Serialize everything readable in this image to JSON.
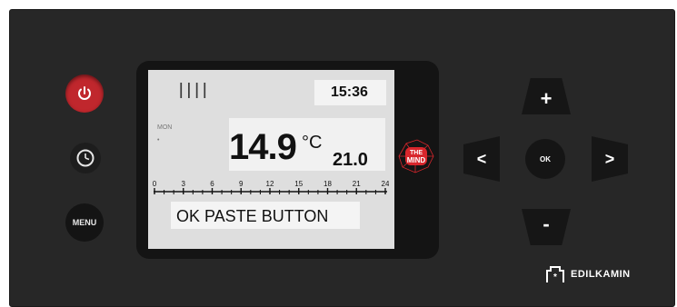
{
  "controls": {
    "power_icon": "power-icon",
    "clock_icon": "clock-icon",
    "menu_label": "MENU",
    "up_label": "+",
    "down_label": "-",
    "left_label": "<",
    "right_label": ">",
    "ok_label": "OK"
  },
  "display": {
    "time": "15:36",
    "day": "MON",
    "dot": "•",
    "temperature": "14.9",
    "unit": "°C",
    "setpoint": "21.0",
    "hour_ticks": [
      "0",
      "3",
      "6",
      "9",
      "12",
      "15",
      "18",
      "21",
      "24"
    ],
    "message": "OK PASTE BUTTON"
  },
  "badge": {
    "line1": "THE",
    "line2": "MIND",
    "color": "#d8262c"
  },
  "brand": {
    "name": "EDILKAMIN"
  },
  "colors": {
    "power": "#c0272d",
    "panel": "#272727",
    "screen": "#dedede"
  }
}
